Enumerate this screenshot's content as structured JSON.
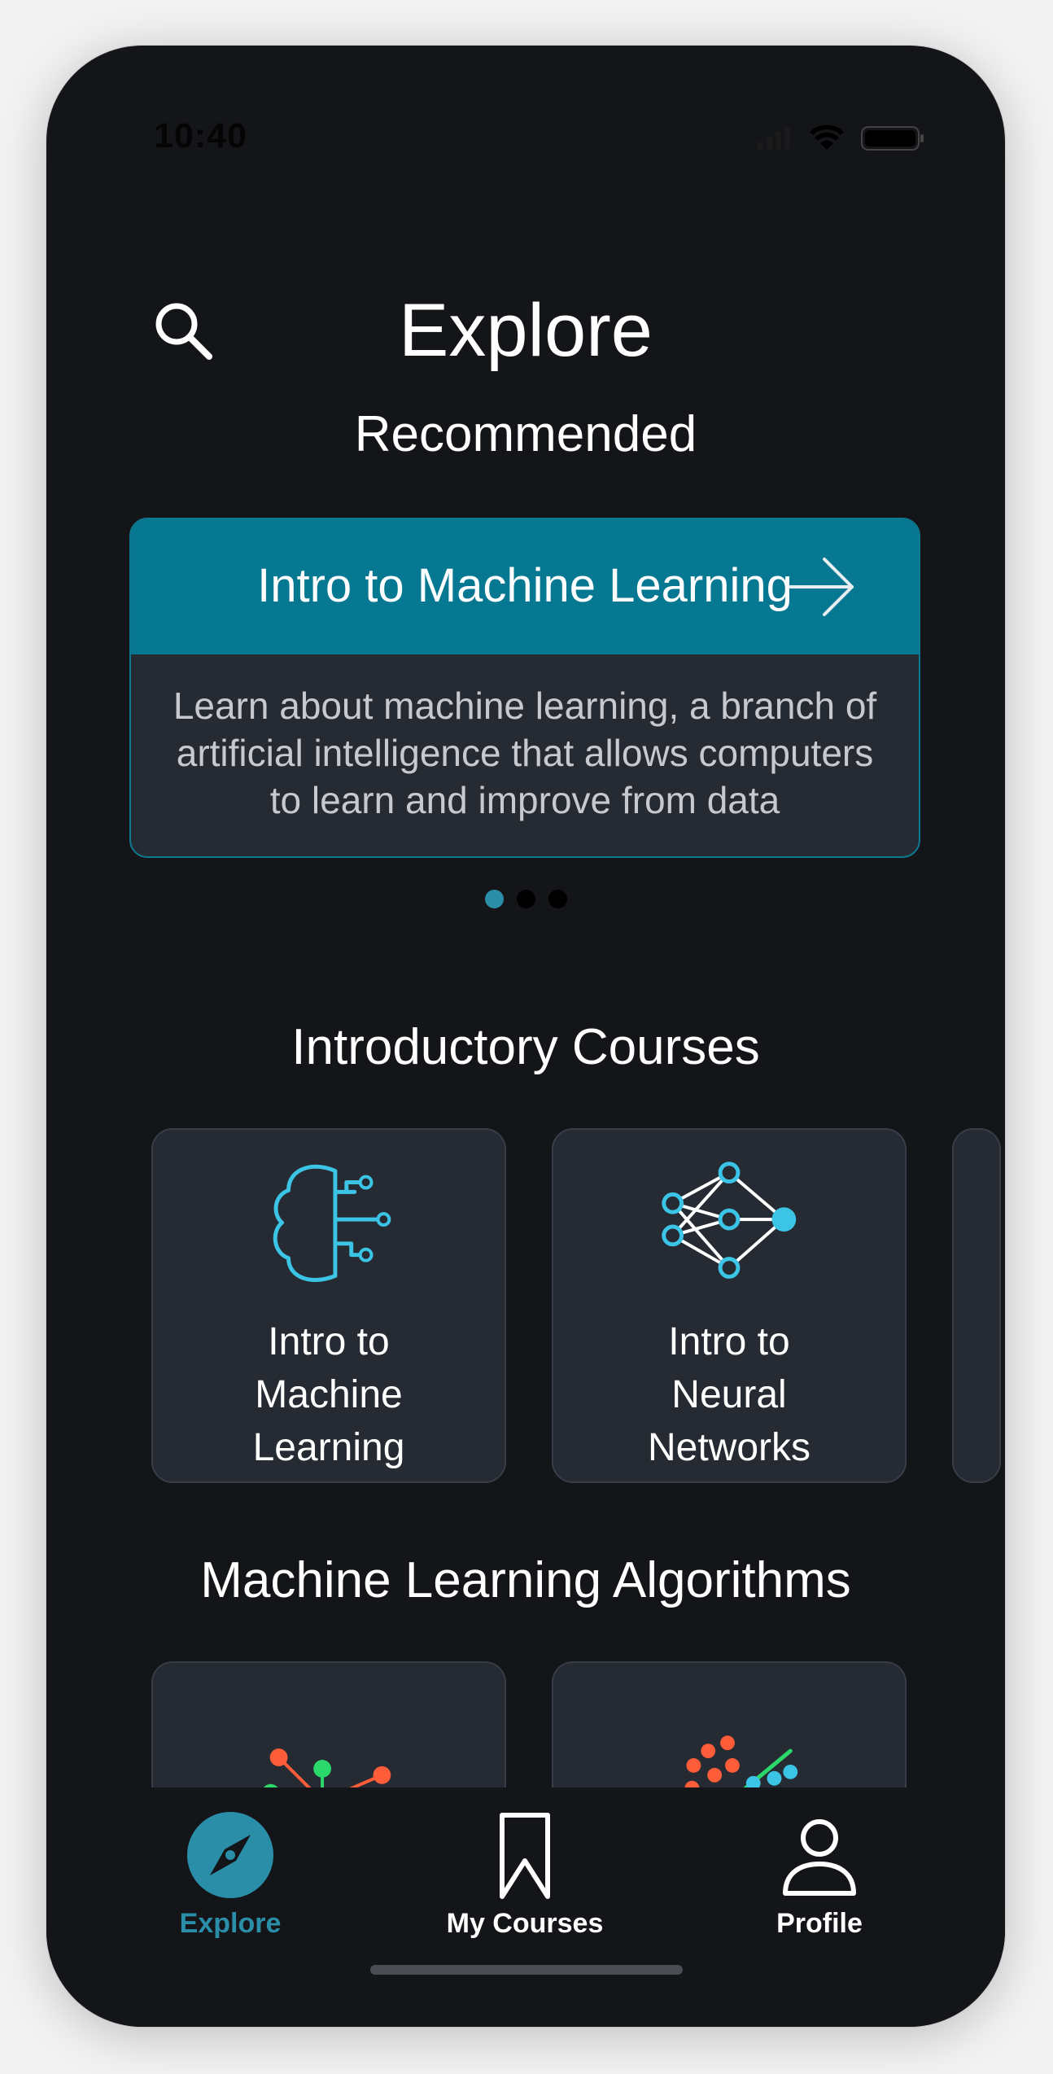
{
  "status_bar": {
    "time": "10:40",
    "icons": [
      "signal-icon",
      "wifi-icon",
      "battery-icon"
    ]
  },
  "header": {
    "title": "Explore",
    "search_icon": "search-icon"
  },
  "recommended": {
    "heading": "Recommended",
    "card": {
      "title": "Intro to Machine Learning",
      "description": "Learn about machine learning, a branch of artificial intelligence that allows computers to learn and improve from data"
    },
    "pagination": {
      "total": 3,
      "active": 0
    }
  },
  "introductory": {
    "heading": "Introductory Courses",
    "courses": [
      {
        "line1": "Intro to",
        "line2": "Machine",
        "line3": "Learning",
        "icon": "brain-circuit-icon"
      },
      {
        "line1": "Intro to",
        "line2": "Neural",
        "line3": "Networks",
        "icon": "neural-network-icon"
      }
    ]
  },
  "algorithms": {
    "heading": "Machine Learning Algorithms",
    "courses": [
      {
        "icon": "tree-graph-icon"
      },
      {
        "icon": "scatter-regression-icon"
      }
    ]
  },
  "tab_bar": {
    "tabs": [
      {
        "label": "Explore",
        "icon": "compass-icon",
        "active": true
      },
      {
        "label": "My Courses",
        "icon": "bookmark-icon",
        "active": false
      },
      {
        "label": "Profile",
        "icon": "person-icon",
        "active": false
      }
    ]
  },
  "colors": {
    "accent": "#2a8ea8",
    "card_header": "#077891",
    "background": "#141518",
    "card": "#262b33",
    "icon_blue": "#3bc4e6",
    "orange": "#ff5c3a",
    "green": "#2bd96b"
  }
}
